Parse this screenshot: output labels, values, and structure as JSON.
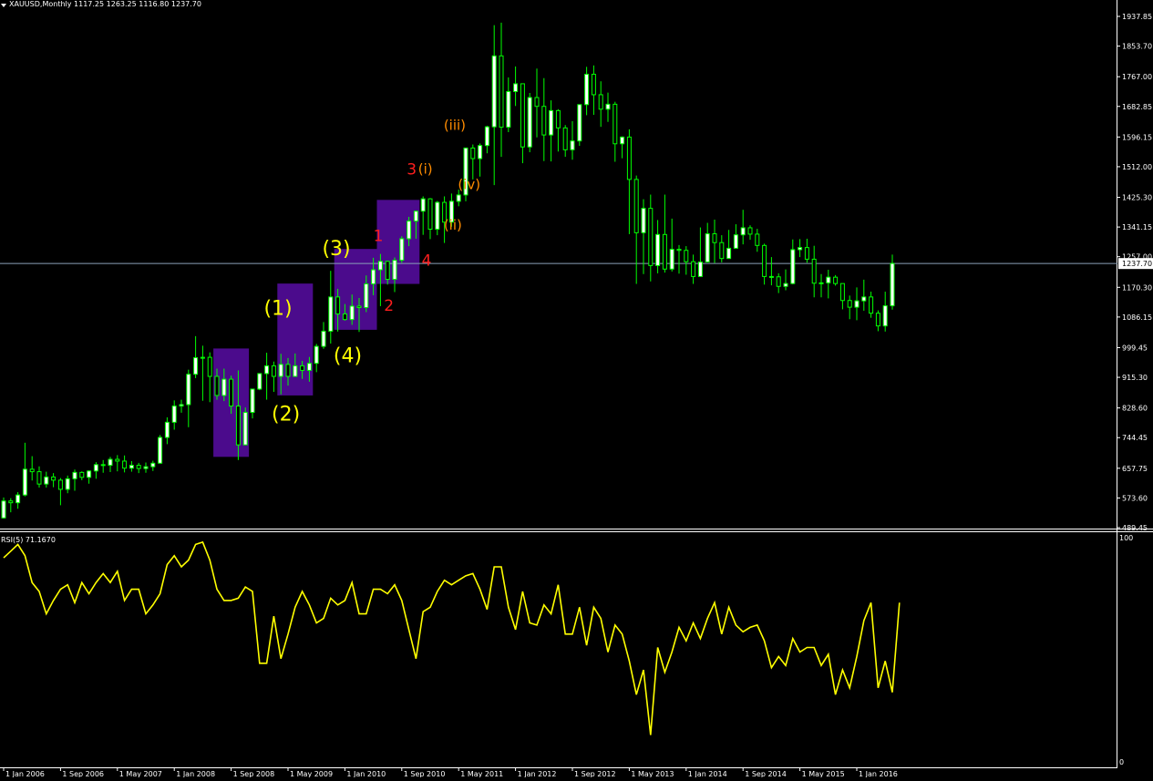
{
  "header": {
    "symbol_line": "XAUUSD,Monthly  1117.25 1263.25 1116.80 1237.70",
    "rsi_line": "RSI(5) 71.1670"
  },
  "colors": {
    "background": "#000000",
    "candle": "#00ff00",
    "candle_body_up": "#ffffff",
    "candle_body_down": "#000000",
    "rsi_line": "#ffff00",
    "box_fill": "#4b0b8c",
    "price_line": "#8aa0b8",
    "wave_yellow": "#ffff00",
    "wave_red": "#ff1e1e",
    "wave_orange": "#ff8c00"
  },
  "chart_data": [
    {
      "type": "candlestick",
      "title": "XAUUSD,Monthly",
      "ylim": [
        489.45,
        1937.85
      ],
      "current_price": 1237.7,
      "y_tick_labels": [
        "1937.85",
        "1853.70",
        "1767.00",
        "1682.85",
        "1596.15",
        "1512.00",
        "1425.30",
        "1341.15",
        "1257.00",
        "1170.30",
        "1086.15",
        "999.45",
        "915.30",
        "828.60",
        "744.45",
        "657.75",
        "573.60",
        "489.45"
      ],
      "y_ticks": [
        1937.85,
        1853.7,
        1767.0,
        1682.85,
        1596.15,
        1512.0,
        1425.3,
        1341.15,
        1257.0,
        1170.3,
        1086.15,
        999.45,
        915.3,
        828.6,
        744.45,
        657.75,
        573.6,
        489.45
      ],
      "x_labels": [
        "1 Jan 2006",
        "1 Sep 2006",
        "1 May 2007",
        "1 Jan 2008",
        "1 Sep 2008",
        "1 May 2009",
        "1 Jan 2010",
        "1 Sep 2010",
        "1 May 2011",
        "1 Jan 2012",
        "1 Sep 2012",
        "1 May 2013",
        "1 Jan 2014",
        "1 Sep 2014",
        "1 May 2015",
        "1 Jan 2016"
      ],
      "x_label_index": [
        0,
        8,
        16,
        24,
        32,
        40,
        48,
        56,
        64,
        72,
        80,
        88,
        96,
        104,
        112,
        120
      ],
      "close": [
        565,
        560,
        582,
        655,
        648,
        613,
        633,
        624,
        598,
        628,
        646,
        632,
        650,
        668,
        666,
        683,
        678,
        658,
        666,
        657,
        662,
        672,
        745,
        788,
        834,
        838,
        924,
        971,
        972,
        918,
        864,
        910,
        834,
        724,
        816,
        882,
        926,
        948,
        918,
        952,
        918,
        948,
        935,
        955,
        1003,
        1046,
        1143,
        1095,
        1079,
        1117,
        1113,
        1180,
        1220,
        1244,
        1193,
        1247,
        1308,
        1358,
        1386,
        1421,
        1335,
        1411,
        1355,
        1414,
        1432,
        1565,
        1535,
        1572,
        1625,
        1826,
        1624,
        1725,
        1747,
        1568,
        1708,
        1683,
        1602,
        1671,
        1622,
        1560,
        1585,
        1688,
        1774,
        1716,
        1675,
        1689,
        1577,
        1596,
        1476,
        1325,
        1394,
        1232,
        1320,
        1222,
        1278,
        1275,
        1243,
        1201,
        1242,
        1322,
        1297,
        1252,
        1281,
        1319,
        1339,
        1321,
        1289,
        1201,
        1200,
        1173,
        1181,
        1277,
        1283,
        1250,
        1182,
        1183,
        1199,
        1181,
        1133,
        1114,
        1132,
        1143,
        1097,
        1061,
        1118,
        1238
      ],
      "open": [
        517,
        565,
        560,
        582,
        655,
        648,
        613,
        633,
        624,
        598,
        628,
        646,
        632,
        650,
        668,
        666,
        683,
        678,
        658,
        666,
        657,
        662,
        672,
        745,
        788,
        834,
        838,
        924,
        971,
        972,
        918,
        864,
        910,
        834,
        724,
        816,
        882,
        926,
        948,
        918,
        952,
        918,
        948,
        935,
        955,
        1003,
        1046,
        1143,
        1095,
        1079,
        1117,
        1113,
        1180,
        1220,
        1244,
        1193,
        1247,
        1308,
        1358,
        1386,
        1421,
        1335,
        1411,
        1355,
        1414,
        1432,
        1565,
        1535,
        1572,
        1625,
        1826,
        1624,
        1725,
        1747,
        1568,
        1708,
        1683,
        1602,
        1671,
        1622,
        1560,
        1585,
        1688,
        1774,
        1716,
        1675,
        1689,
        1577,
        1596,
        1476,
        1325,
        1394,
        1232,
        1320,
        1222,
        1278,
        1275,
        1243,
        1201,
        1242,
        1322,
        1297,
        1252,
        1281,
        1319,
        1339,
        1321,
        1289,
        1201,
        1200,
        1173,
        1181,
        1277,
        1283,
        1250,
        1182,
        1183,
        1199,
        1181,
        1133,
        1114,
        1132,
        1143,
        1097,
        1061,
        1118
      ],
      "high": [
        575,
        573,
        590,
        730,
        692,
        663,
        648,
        644,
        630,
        637,
        654,
        649,
        652,
        675,
        681,
        690,
        695,
        694,
        678,
        673,
        674,
        679,
        752,
        802,
        850,
        852,
        937,
        1032,
        1005,
        986,
        940,
        940,
        920,
        935,
        830,
        880,
        919,
        985,
        960,
        982,
        970,
        983,
        962,
        973,
        1010,
        1072,
        1217,
        1166,
        1123,
        1150,
        1140,
        1204,
        1254,
        1265,
        1246,
        1255,
        1315,
        1370,
        1388,
        1428,
        1423,
        1415,
        1428,
        1436,
        1447,
        1547,
        1575,
        1578,
        1628,
        1913,
        1920,
        1765,
        1796,
        1713,
        1721,
        1790,
        1763,
        1700,
        1675,
        1630,
        1641,
        1680,
        1795,
        1799,
        1754,
        1722,
        1696,
        1598,
        1618,
        1487,
        1420,
        1433,
        1361,
        1433,
        1365,
        1290,
        1287,
        1263,
        1340,
        1353,
        1362,
        1318,
        1333,
        1349,
        1390,
        1346,
        1336,
        1294,
        1256,
        1210,
        1221,
        1306,
        1307,
        1308,
        1288,
        1208,
        1220,
        1205,
        1180,
        1147,
        1170,
        1192,
        1158,
        1105,
        1158,
        1263
      ],
      "low": [
        515,
        533,
        543,
        578,
        623,
        603,
        603,
        604,
        553,
        587,
        594,
        624,
        614,
        628,
        645,
        647,
        649,
        646,
        648,
        644,
        645,
        650,
        670,
        726,
        767,
        815,
        774,
        913,
        849,
        845,
        852,
        848,
        812,
        681,
        731,
        799,
        879,
        852,
        874,
        867,
        892,
        917,
        911,
        903,
        930,
        996,
        1011,
        1045,
        1076,
        1064,
        1044,
        1100,
        1148,
        1117,
        1178,
        1157,
        1240,
        1287,
        1308,
        1319,
        1307,
        1318,
        1296,
        1342,
        1400,
        1414,
        1476,
        1484,
        1550,
        1460,
        1540,
        1610,
        1684,
        1522,
        1553,
        1595,
        1528,
        1527,
        1555,
        1540,
        1532,
        1571,
        1658,
        1659,
        1625,
        1639,
        1526,
        1536,
        1321,
        1180,
        1208,
        1187,
        1210,
        1212,
        1215,
        1209,
        1206,
        1180,
        1220,
        1268,
        1239,
        1241,
        1254,
        1282,
        1292,
        1305,
        1271,
        1178,
        1176,
        1154,
        1162,
        1179,
        1256,
        1240,
        1142,
        1142,
        1139,
        1175,
        1108,
        1080,
        1077,
        1104,
        1084,
        1046,
        1045,
        1107
      ]
    },
    {
      "type": "line",
      "title": "RSI(5) 71.1670",
      "ylim": [
        0,
        100
      ],
      "y_tick_labels": [
        "100",
        "0"
      ],
      "values": [
        91,
        94,
        97,
        92,
        80,
        76,
        66,
        72,
        77,
        79,
        71,
        80,
        75,
        80,
        84,
        80,
        85,
        72,
        77,
        77,
        66,
        70,
        75,
        88,
        92,
        87,
        90,
        97,
        98,
        90,
        77,
        72,
        72,
        73,
        78,
        76,
        44,
        44,
        65,
        46,
        57,
        69,
        76,
        70,
        62,
        64,
        73,
        70,
        72,
        80,
        66,
        66,
        77,
        77,
        75,
        79,
        72,
        59,
        46,
        67,
        69,
        76,
        81,
        79,
        81,
        83,
        84,
        77,
        68,
        87,
        87,
        69,
        59,
        76,
        62,
        61,
        70,
        66,
        79,
        57,
        57,
        69,
        52,
        69,
        64,
        49,
        61,
        57,
        45,
        30,
        41,
        12,
        51,
        40,
        49,
        60,
        54,
        62,
        55,
        64,
        71,
        57,
        69,
        61,
        58,
        60,
        61,
        54,
        42,
        47,
        43,
        55,
        49,
        51,
        51,
        43,
        48,
        30,
        41,
        33,
        47,
        63,
        71,
        33,
        45,
        31,
        71
      ],
      "x_labels_shared": true
    }
  ],
  "annotations": {
    "boxes": [
      {
        "x0": 29.5,
        "x1": 34.5,
        "y0": 690,
        "y1": 997
      },
      {
        "x0": 38.5,
        "x1": 43.5,
        "y0": 864,
        "y1": 1181
      },
      {
        "x0": 46.5,
        "x1": 52.5,
        "y0": 1050,
        "y1": 1279
      },
      {
        "x0": 52.5,
        "x1": 58.5,
        "y0": 1180,
        "y1": 1418
      }
    ],
    "labels": [
      {
        "text": "(1)",
        "x": 36.6,
        "y": 1092,
        "color": "wave_yellow",
        "size": 22
      },
      {
        "text": "(2)",
        "x": 37.7,
        "y": 793,
        "color": "wave_yellow",
        "size": 22
      },
      {
        "text": "(3)",
        "x": 44.8,
        "y": 1261,
        "color": "wave_yellow",
        "size": 22
      },
      {
        "text": "(4)",
        "x": 46.4,
        "y": 958,
        "color": "wave_yellow",
        "size": 22
      },
      {
        "text": "1",
        "x": 52.0,
        "y": 1301,
        "color": "wave_red",
        "size": 17
      },
      {
        "text": "2",
        "x": 53.5,
        "y": 1104,
        "color": "wave_red",
        "size": 17
      },
      {
        "text": "3",
        "x": 56.7,
        "y": 1490,
        "color": "wave_red",
        "size": 17
      },
      {
        "text": "4",
        "x": 58.8,
        "y": 1232,
        "color": "wave_red",
        "size": 17
      },
      {
        "text": "(i)",
        "x": 58.3,
        "y": 1493,
        "color": "wave_orange",
        "size": 15
      },
      {
        "text": "(ii)",
        "x": 61.9,
        "y": 1334,
        "color": "wave_orange",
        "size": 15
      },
      {
        "text": "(iii)",
        "x": 61.9,
        "y": 1616,
        "color": "wave_orange",
        "size": 15
      },
      {
        "text": "(iv)",
        "x": 63.9,
        "y": 1448,
        "color": "wave_orange",
        "size": 15
      }
    ]
  }
}
